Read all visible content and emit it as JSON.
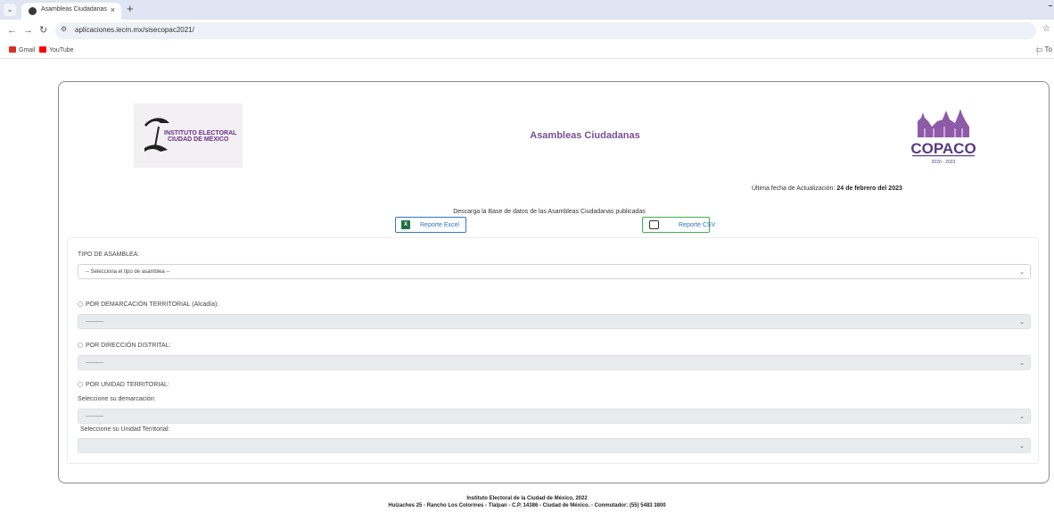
{
  "browser": {
    "tab_title": "Asambleas Ciudadanas",
    "tab_close": "×",
    "new_tab": "+",
    "url": "aplicaciones.iecm.mx/sisecopac2021/",
    "bookmarks": [
      {
        "label": "Gmail",
        "icon": "gmail-icon",
        "color": "#d93025"
      },
      {
        "label": "YouTube",
        "icon": "youtube-icon",
        "color": "#ff0000"
      }
    ],
    "folder_label": "To"
  },
  "header": {
    "title": "Asambleas Ciudadanas",
    "logo_left_text_1": "INSTITUTO ELECTORAL",
    "logo_left_text_2": "CIUDAD DE MÉXICO",
    "logo_right_text": "COPACO",
    "logo_right_years": "2020 - 2023",
    "update_label": "Última fecha de Actualización:",
    "update_date": "24 de febrero del 2023"
  },
  "download": {
    "caption": "Descarga la Base de datos de las Asambleas Ciudadanas publicadas",
    "excel_label": "Reporte Excel",
    "csv_label": "Reporte CSV"
  },
  "form": {
    "tipo_label": "TIPO DE ASAMBLEA:",
    "tipo_placeholder": "-- Selecciona el tipo de asamblea --",
    "demarcacion_label": "POR DEMARCACIÓN TERRITORIAL (Alcadía):",
    "demarcacion_value": "----------",
    "distrital_label": "POR DIRECCIÓN DISTRITAL:",
    "distrital_value": "----------",
    "unidad_label": "POR UNIDAD TERRITORIAL:",
    "seleccione_demarcacion_label": "Seleccione su demarcación:",
    "seleccione_demarcacion_value": "----------",
    "seleccione_unidad_label": "Seleccione su Unidad Territorial:",
    "seleccione_unidad_value": ""
  },
  "footer": {
    "line1": "Instituto Electoral de la Ciudad de México, 2022",
    "line2": "Huizaches 25 - Rancho Los Colorines - Tlalpan - C.P. 14386 - Ciudad de México. - Conmutador: (55) 5483 3800"
  },
  "colors": {
    "accent_purple": "#7b4f96",
    "excel_border": "#2f78c7",
    "csv_border": "#3cb34a"
  }
}
